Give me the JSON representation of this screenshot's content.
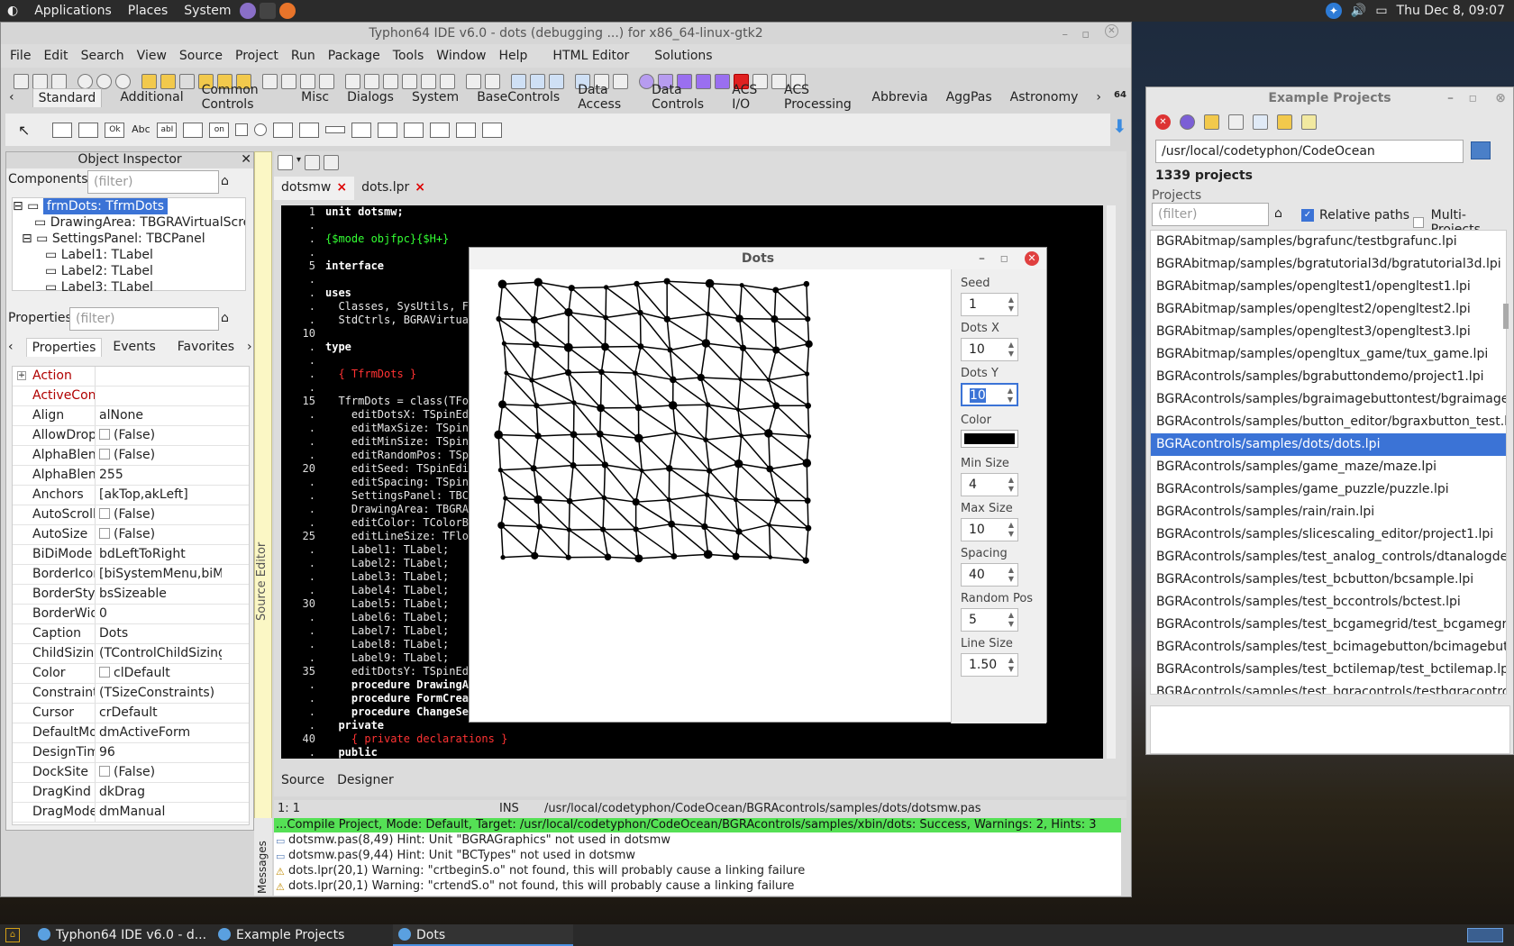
{
  "topbar": {
    "menus": [
      "Applications",
      "Places",
      "System"
    ],
    "clock": "Thu Dec  8, 09:07"
  },
  "ide": {
    "title": "Typhon64 IDE v6.0 - dots (debugging ...) for x86_64-linux-gtk2",
    "menu": [
      "File",
      "Edit",
      "Search",
      "View",
      "Source",
      "Project",
      "Run",
      "Package",
      "Tools",
      "Window",
      "Help",
      "HTML Editor",
      "Solutions"
    ],
    "palette_tabs": [
      "Standard",
      "Additional",
      "Common Controls",
      "Misc",
      "Dialogs",
      "System",
      "BaseControls",
      "Data Access",
      "Data Controls",
      "ACS I/O",
      "ACS Processing",
      "Abbrevia",
      "AggPas",
      "Astronomy"
    ],
    "palette_counter": "64",
    "palette_icon_labels": [
      "Ok",
      "Abc",
      "abI",
      "on"
    ]
  },
  "object_inspector": {
    "title": "Object Inspector",
    "components_label": "Components",
    "filter_placeholder": "(filter)",
    "tree": [
      "frmDots: TfrmDots",
      "DrawingArea: TBGRAVirtualScre",
      "SettingsPanel: TBCPanel",
      "Label1: TLabel",
      "Label2: TLabel",
      "Label3: TLabel"
    ],
    "properties_label": "Properties",
    "tabs": [
      "Properties",
      "Events",
      "Favorites"
    ],
    "props": [
      {
        "name": "Action",
        "value": "",
        "red": true
      },
      {
        "name": "ActiveControl",
        "value": "",
        "red": true
      },
      {
        "name": "Align",
        "value": "alNone"
      },
      {
        "name": "AllowDropFile",
        "value": "(False)",
        "check": true
      },
      {
        "name": "AlphaBlend",
        "value": "(False)",
        "check": true
      },
      {
        "name": "AlphaBlendVa",
        "value": "255"
      },
      {
        "name": "Anchors",
        "value": "[akTop,akLeft]",
        "expand": true
      },
      {
        "name": "AutoScroll",
        "value": "(False)",
        "check": true
      },
      {
        "name": "AutoSize",
        "value": "(False)",
        "check": true
      },
      {
        "name": "BiDiMode",
        "value": "bdLeftToRight"
      },
      {
        "name": "BorderIcons",
        "value": "[biSystemMenu,biMin",
        "expand": true
      },
      {
        "name": "BorderStyle",
        "value": "bsSizeable"
      },
      {
        "name": "BorderWidth",
        "value": "0"
      },
      {
        "name": "Caption",
        "value": "Dots"
      },
      {
        "name": "ChildSizing",
        "value": "(TControlChildSizing)",
        "expand": true
      },
      {
        "name": "Color",
        "value": "clDefault",
        "check": true
      },
      {
        "name": "Constraints",
        "value": "(TSizeConstraints)",
        "expand": true
      },
      {
        "name": "Cursor",
        "value": "crDefault"
      },
      {
        "name": "DefaultMonito",
        "value": "dmActiveForm"
      },
      {
        "name": "DesignTimePI",
        "value": "96"
      },
      {
        "name": "DockSite",
        "value": "(False)",
        "check": true
      },
      {
        "name": "DragKind",
        "value": "dkDrag"
      },
      {
        "name": "DragMode",
        "value": "dmManual"
      }
    ]
  },
  "source_editor": {
    "strip_label": "Source Editor",
    "tabs": [
      {
        "label": "dotsmw"
      },
      {
        "label": "dots.lpr"
      }
    ],
    "close_glyph": "×",
    "gutter": [
      "1",
      ".",
      ".",
      ".",
      "5",
      ".",
      ".",
      ".",
      ".",
      "10",
      ".",
      ".",
      ".",
      ".",
      "15",
      ".",
      ".",
      ".",
      ".",
      "20",
      ".",
      ".",
      ".",
      ".",
      "25",
      ".",
      ".",
      ".",
      ".",
      "30",
      ".",
      ".",
      ".",
      ".",
      "35",
      ".",
      ".",
      ".",
      ".",
      "40",
      "."
    ],
    "lines": [
      {
        "t": "unit dotsmw;",
        "c": "kw"
      },
      {
        "t": "",
        "c": ""
      },
      {
        "t": "{$mode objfpc}{$H+}",
        "c": "dir"
      },
      {
        "t": "",
        "c": ""
      },
      {
        "t": "interface",
        "c": "kw"
      },
      {
        "t": "",
        "c": ""
      },
      {
        "t": "uses",
        "c": "kw"
      },
      {
        "t": "  Classes, SysUtils, Fi",
        "c": ""
      },
      {
        "t": "  StdCtrls, BGRAVirtual",
        "c": ""
      },
      {
        "t": "",
        "c": ""
      },
      {
        "t": "type",
        "c": "kw"
      },
      {
        "t": "",
        "c": ""
      },
      {
        "t": "  { TfrmDots }",
        "c": "cm"
      },
      {
        "t": "",
        "c": ""
      },
      {
        "t": "  TfrmDots = class(TFor",
        "c": ""
      },
      {
        "t": "    editDotsX: TSpinEdi",
        "c": ""
      },
      {
        "t": "    editMaxSize: TSpinE",
        "c": ""
      },
      {
        "t": "    editMinSize: TSpinE",
        "c": ""
      },
      {
        "t": "    editRandomPos: TSpi",
        "c": ""
      },
      {
        "t": "    editSeed: TSpinEdit",
        "c": ""
      },
      {
        "t": "    editSpacing: TSpinE",
        "c": ""
      },
      {
        "t": "    SettingsPanel: TBCP",
        "c": ""
      },
      {
        "t": "    DrawingArea: TBGRAV",
        "c": ""
      },
      {
        "t": "    editColor: TColorBu",
        "c": ""
      },
      {
        "t": "    editLineSize: TFloa",
        "c": ""
      },
      {
        "t": "    Label1: TLabel;",
        "c": ""
      },
      {
        "t": "    Label2: TLabel;",
        "c": ""
      },
      {
        "t": "    Label3: TLabel;",
        "c": ""
      },
      {
        "t": "    Label4: TLabel;",
        "c": ""
      },
      {
        "t": "    Label5: TLabel;",
        "c": ""
      },
      {
        "t": "    Label6: TLabel;",
        "c": ""
      },
      {
        "t": "    Label7: TLabel;",
        "c": ""
      },
      {
        "t": "    Label8: TLabel;",
        "c": ""
      },
      {
        "t": "    Label9: TLabel;",
        "c": ""
      },
      {
        "t": "    editDotsY: TSpinEdi",
        "c": ""
      },
      {
        "t": "    procedure DrawingAr",
        "c": "kw"
      },
      {
        "t": "    procedure FormCreat",
        "c": "kw"
      },
      {
        "t": "    procedure ChangeSet",
        "c": "kw"
      },
      {
        "t": "  private",
        "c": "kw"
      },
      {
        "t": "    { private declarations }",
        "c": "cm"
      },
      {
        "t": "  public",
        "c": "kw"
      }
    ],
    "bottom_tabs": [
      "Source",
      "Designer"
    ],
    "status_pos": "1:  1",
    "status_mode": "INS",
    "status_file": "/usr/local/codetyphon/CodeOcean/BGRAcontrols/samples/dots/dotsmw.pas"
  },
  "messages": {
    "strip_label": "Messages",
    "compile": "...Compile Project, Mode: Default, Target: /usr/local/codetyphon/CodeOcean/BGRAcontrols/samples/xbin/dots: Success, Warnings: 2, Hints: 3",
    "items": [
      {
        "type": "hint",
        "text": "dotsmw.pas(8,49) Hint: Unit \"BGRAGraphics\" not used in dotsmw"
      },
      {
        "type": "hint",
        "text": "dotsmw.pas(9,44) Hint: Unit \"BCTypes\" not used in dotsmw"
      },
      {
        "type": "warning",
        "text": "dots.lpr(20,1) Warning: \"crtbeginS.o\" not found, this will probably cause a linking failure"
      },
      {
        "type": "warning",
        "text": "dots.lpr(20,1) Warning: \"crtendS.o\" not found, this will probably cause a linking failure"
      }
    ]
  },
  "example_projects": {
    "title": "Example Projects",
    "path": "/usr/local/codetyphon/CodeOcean",
    "count": "1339 projects",
    "projects_label": "Projects",
    "filter_placeholder": "(filter)",
    "relative_paths": "Relative paths",
    "multi_projects": "Multi-Projects",
    "items": [
      "BGRAbitmap/samples/bgrafunc/testbgrafunc.lpi",
      "BGRAbitmap/samples/bgratutorial3d/bgratutorial3d.lpi",
      "BGRAbitmap/samples/opengltest1/opengltest1.lpi",
      "BGRAbitmap/samples/opengltest2/opengltest2.lpi",
      "BGRAbitmap/samples/opengltest3/opengltest3.lpi",
      "BGRAbitmap/samples/opengltux_game/tux_game.lpi",
      "BGRAcontrols/samples/bgrabuttondemo/project1.lpi",
      "BGRAcontrols/samples/bgraimagebuttontest/bgraimagebut",
      "BGRAcontrols/samples/button_editor/bgraxbutton_test.lpi",
      "BGRAcontrols/samples/dots/dots.lpi",
      "BGRAcontrols/samples/game_maze/maze.lpi",
      "BGRAcontrols/samples/game_puzzle/puzzle.lpi",
      "BGRAcontrols/samples/rain/rain.lpi",
      "BGRAcontrols/samples/slicescaling_editor/project1.lpi",
      "BGRAcontrols/samples/test_analog_controls/dtanalogdemo",
      "BGRAcontrols/samples/test_bcbutton/bcsample.lpi",
      "BGRAcontrols/samples/test_bccontrols/bctest.lpi",
      "BGRAcontrols/samples/test_bcgamegrid/test_bcgamegrid.lp",
      "BGRAcontrols/samples/test_bcimagebutton/bcimagebutton",
      "BGRAcontrols/samples/test_bctilemap/test_bctilemap.lpi",
      "BGRAcontrols/samples/test_bgracontrols/testbgracontrols.l"
    ],
    "selected_index": 9
  },
  "dots": {
    "title": "Dots",
    "seed_label": "Seed",
    "seed": "1",
    "dotsx_label": "Dots X",
    "dotsx": "10",
    "dotsy_label": "Dots Y",
    "dotsy": "10",
    "color_label": "Color",
    "color": "#000000",
    "minsize_label": "Min Size",
    "minsize": "4",
    "maxsize_label": "Max Size",
    "maxsize": "10",
    "spacing_label": "Spacing",
    "spacing": "40",
    "randompos_label": "Random Pos",
    "randompos": "5",
    "linesize_label": "Line Size",
    "linesize": "1.50",
    "close_glyph": "✕"
  },
  "taskbar": {
    "items": [
      "Typhon64 IDE v6.0 - d...",
      "Example Projects",
      "Dots"
    ],
    "active_index": 2
  },
  "colors": {
    "selection": "#3b73d6",
    "success": "#55e055",
    "editor_bg": "#000000",
    "keyword": "#ffffff",
    "comment": "#ff3333",
    "directive": "#33ff33"
  }
}
